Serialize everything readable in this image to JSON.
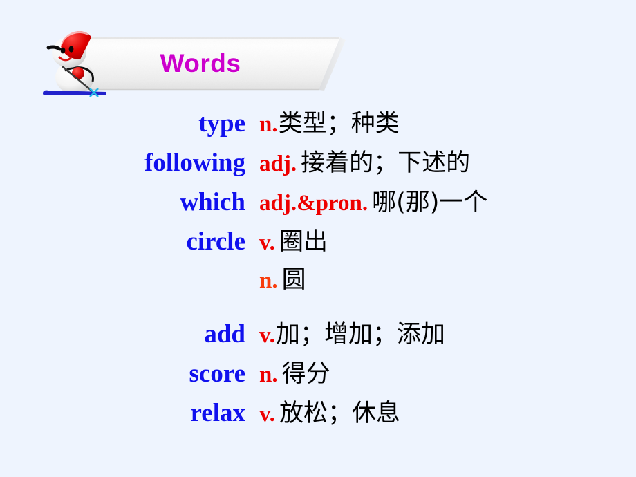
{
  "slide": {
    "background_color": "#eef4fe",
    "title": "Words",
    "title_color": "#cc00cc",
    "mascot": "snowman-skier-icon"
  },
  "colors": {
    "english_word": "#1010ee",
    "part_of_speech": "#ee0000",
    "part_of_speech_alt": "#f83c0c",
    "definition": "#000000",
    "banner": "#ffffff"
  },
  "vocabulary": [
    {
      "word": "type",
      "pos": "n.",
      "definition": "类型；种类"
    },
    {
      "word": "following",
      "pos": "adj.",
      "definition": "接着的；下述的"
    },
    {
      "word": "which",
      "pos": "adj.&pron.",
      "definition": "哪(那)一个"
    },
    {
      "word": "circle",
      "pos": "v.",
      "definition": "圈出"
    },
    {
      "word": "",
      "pos": "n.",
      "definition": "圆"
    },
    {
      "word": "add",
      "pos": "v.",
      "definition": "加；增加；添加"
    },
    {
      "word": "score",
      "pos": "n.",
      "definition": "得分"
    },
    {
      "word": "relax",
      "pos": "v.",
      "definition": "放松；休息"
    }
  ]
}
